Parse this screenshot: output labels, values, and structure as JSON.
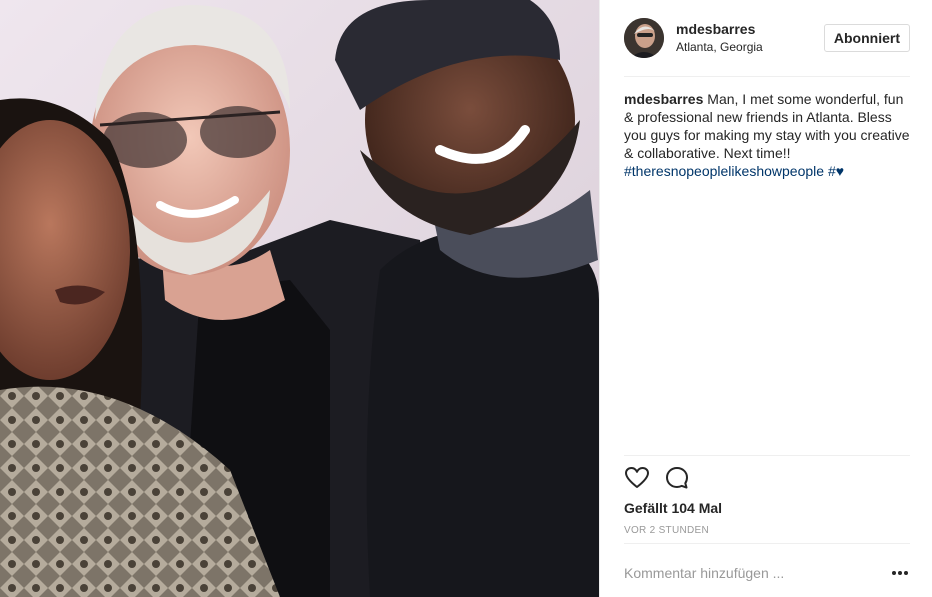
{
  "post": {
    "username": "mdesbarres",
    "location": "Atlanta, Georgia",
    "follow_label": "Abonniert",
    "caption_user": "mdesbarres",
    "caption_text": " Man, I met some wonderful, fun & professional new friends in Atlanta. Bless you guys for making my stay with you creative & collaborative. Next time!!",
    "hashtag": "#theresnopeoplelikeshowpeople",
    "hashtag2": "#",
    "heart_emoji": "♥",
    "likes": "Gefällt 104 Mal",
    "timestamp": "VOR 2 STUNDEN",
    "comment_placeholder": "Kommentar hinzufügen ...",
    "more_icon": "•••"
  },
  "colors": {
    "hashtag": "#003569",
    "text": "#262626",
    "muted": "#999999",
    "divider": "#efefef"
  },
  "icons": {
    "like": "heart-icon",
    "comment": "speech-bubble-icon",
    "more": "ellipsis-icon"
  }
}
